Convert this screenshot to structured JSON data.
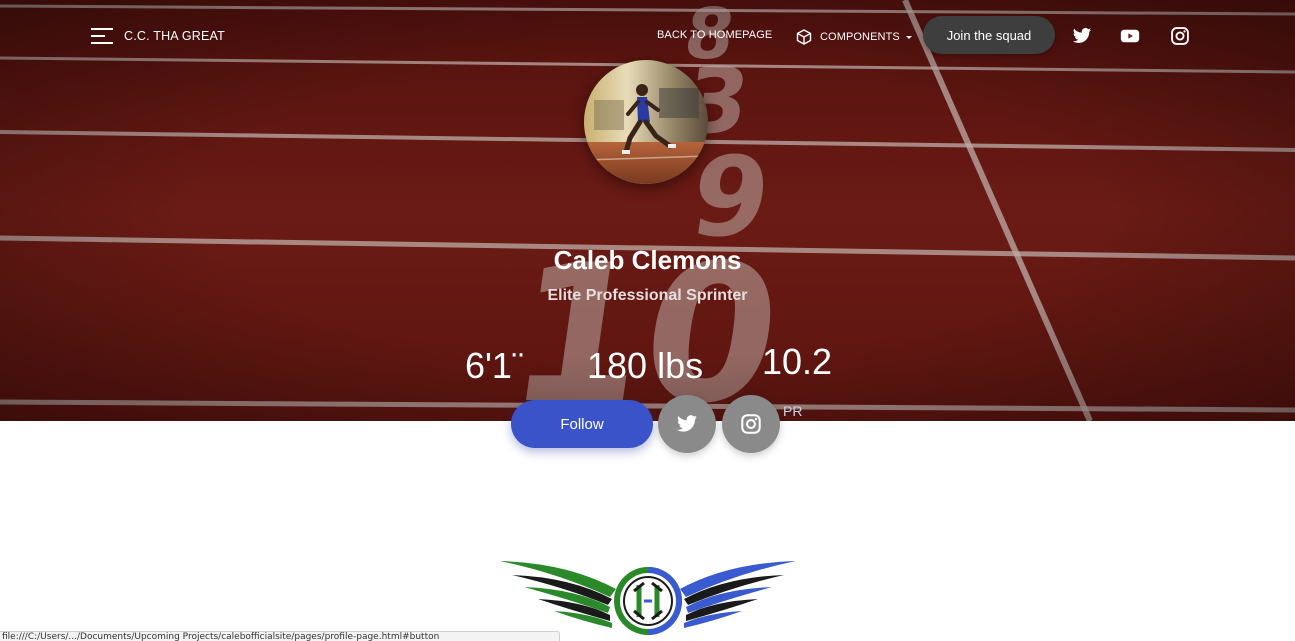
{
  "nav": {
    "brand": "C.C. THA GREAT",
    "back_link": "BACK TO HOMEPAGE",
    "components": "COMPONENTS",
    "join_button": "Join the squad",
    "social_icons": [
      "twitter-icon",
      "youtube-icon",
      "instagram-icon"
    ]
  },
  "profile": {
    "name": "Caleb Clemons",
    "title": "Elite Professional Sprinter",
    "height": "6'1¨",
    "weight": "180 lbs",
    "pr_value": "10.2",
    "pr_label": "PR"
  },
  "actions": {
    "follow": "Follow",
    "icons": [
      "twitter-icon",
      "instagram-icon"
    ]
  },
  "status_bar": {
    "url": "file:///C:/Users/.../Documents/Upcoming Projects/calebofficialsite/pages/profile-page.html#button"
  },
  "colors": {
    "track": "#6e1a16",
    "follow": "#3a53c8",
    "join": "#3e3e3e",
    "circle_buttons": "#8a8a8a",
    "logo_green": "#2a8a2a",
    "logo_blue": "#3a5ad0"
  }
}
